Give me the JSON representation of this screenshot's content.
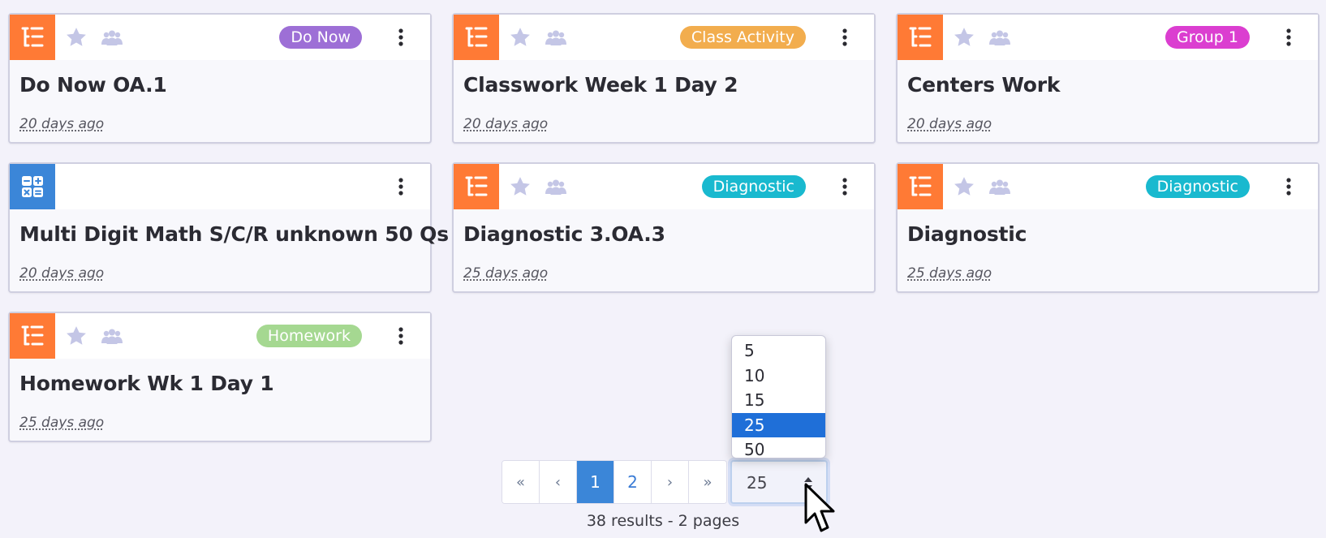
{
  "colors": {
    "type_list_bg": "#ff7a35",
    "type_calc_bg": "#3b86d8",
    "star": "#c4c6e6",
    "group": "#c4c6e6"
  },
  "cards": [
    {
      "type_icon": "list-icon",
      "title": "Do Now OA.1",
      "date": "20 days ago",
      "badge": "Do Now",
      "badge_color": "#9d6fd6",
      "has_star": true
    },
    {
      "type_icon": "list-icon",
      "title": "Classwork Week 1 Day 2",
      "date": "20 days ago",
      "badge": "Class Activity",
      "badge_color": "#f2ad4e",
      "has_star": true
    },
    {
      "type_icon": "list-icon",
      "title": "Centers Work",
      "date": "20 days ago",
      "badge": "Group 1",
      "badge_color": "#db3ed0",
      "has_star": true
    },
    {
      "type_icon": "calculator-icon",
      "title": "Multi Digit Math S/C/R unknown 50 Qs",
      "date": "20 days ago",
      "badge": "",
      "badge_color": "",
      "has_star": false
    },
    {
      "type_icon": "list-icon",
      "title": "Diagnostic 3.OA.3",
      "date": "25 days ago",
      "badge": "Diagnostic",
      "badge_color": "#19b9cf",
      "has_star": true
    },
    {
      "type_icon": "list-icon",
      "title": "Diagnostic",
      "date": "25 days ago",
      "badge": "Diagnostic",
      "badge_color": "#19b9cf",
      "has_star": true
    },
    {
      "type_icon": "list-icon",
      "title": "Homework Wk 1 Day 1",
      "date": "25 days ago",
      "badge": "Homework",
      "badge_color": "#a5d891",
      "has_star": true
    }
  ],
  "pagination": {
    "first": "«",
    "prev": "‹",
    "pages": [
      "1",
      "2"
    ],
    "current": "1",
    "next": "›",
    "last": "»"
  },
  "per_page": {
    "value": "25",
    "options": [
      "5",
      "10",
      "15",
      "25",
      "50"
    ],
    "selected": "25"
  },
  "results_text": "38 results - 2 pages"
}
